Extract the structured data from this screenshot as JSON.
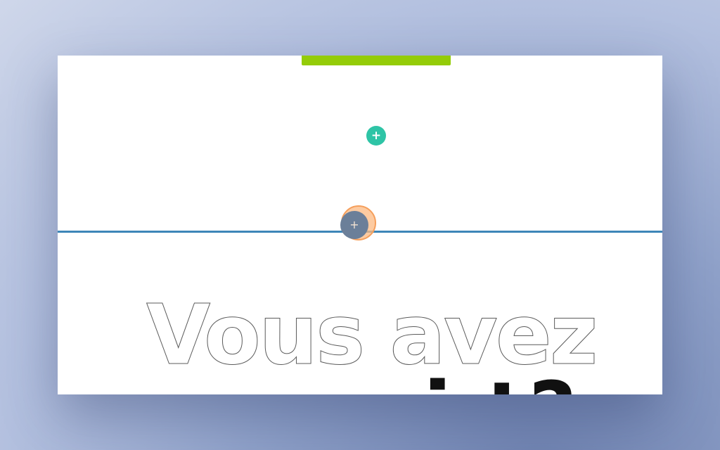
{
  "canvas": {
    "top_bar_color": "#94cc08",
    "divider_color": "#3d86b8"
  },
  "add_module_button": {
    "icon": "plus-icon",
    "symbol": "+",
    "color": "#2ec4a6"
  },
  "add_section_button": {
    "icon": "plus-icon",
    "symbol": "+",
    "color": "#6b7f99",
    "hover_ring_color": "#f59f5c"
  },
  "heading": {
    "outline_text": "Vous avez",
    "solid_text_partial": "i t?"
  }
}
